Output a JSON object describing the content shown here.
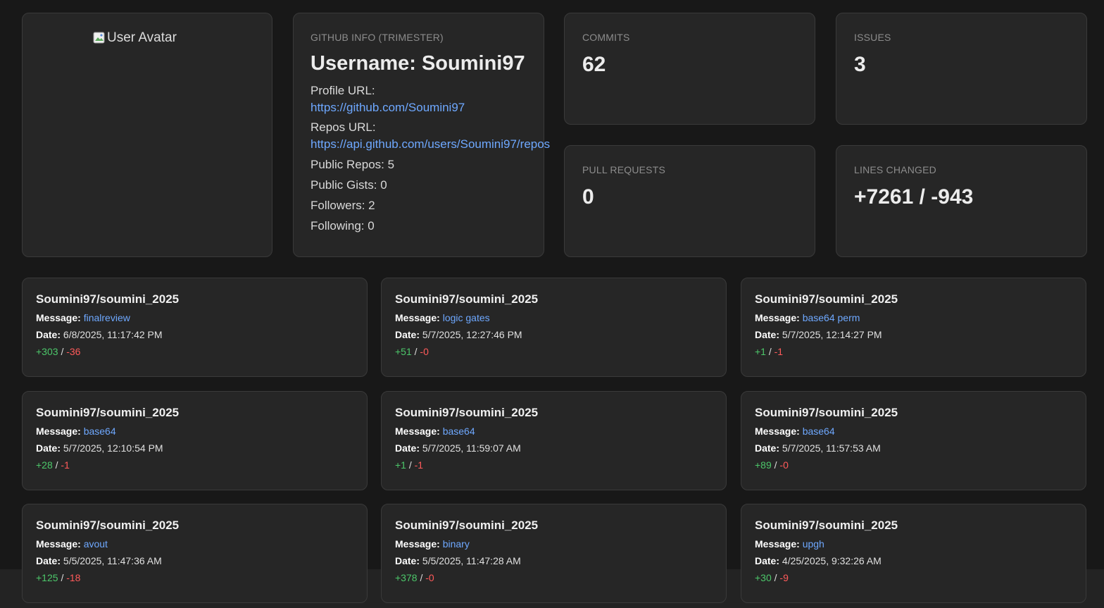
{
  "avatar": {
    "alt_text": "User Avatar"
  },
  "github_info": {
    "section_label": "GITHUB INFO (TRIMESTER)",
    "username": "Username: Soumini97",
    "profile_url_label": "Profile URL:",
    "profile_url": "https://github.com/Soumini97",
    "repos_url_label": "Repos URL:",
    "repos_url": "https://api.github.com/users/Soumini97/repos",
    "public_repos": "Public Repos: 5",
    "public_gists": "Public Gists: 0",
    "followers": "Followers: 2",
    "following": "Following: 0"
  },
  "stats": {
    "commits": {
      "label": "COMMITS",
      "value": "62"
    },
    "issues": {
      "label": "ISSUES",
      "value": "3"
    },
    "pull_requests": {
      "label": "PULL REQUESTS",
      "value": "0"
    },
    "lines_changed": {
      "label": "LINES CHANGED",
      "value": "+7261 / -943"
    }
  },
  "commit_labels": {
    "message": "Message:",
    "date": "Date:",
    "separator": "/"
  },
  "commits": [
    {
      "repo": "Soumini97/soumini_2025",
      "message": "finalreview",
      "date": "6/8/2025, 11:17:42 PM",
      "additions": "+303",
      "deletions": "-36"
    },
    {
      "repo": "Soumini97/soumini_2025",
      "message": "logic gates",
      "date": "5/7/2025, 12:27:46 PM",
      "additions": "+51",
      "deletions": "-0"
    },
    {
      "repo": "Soumini97/soumini_2025",
      "message": "base64 perm",
      "date": "5/7/2025, 12:14:27 PM",
      "additions": "+1",
      "deletions": "-1"
    },
    {
      "repo": "Soumini97/soumini_2025",
      "message": "base64",
      "date": "5/7/2025, 12:10:54 PM",
      "additions": "+28",
      "deletions": "-1"
    },
    {
      "repo": "Soumini97/soumini_2025",
      "message": "base64",
      "date": "5/7/2025, 11:59:07 AM",
      "additions": "+1",
      "deletions": "-1"
    },
    {
      "repo": "Soumini97/soumini_2025",
      "message": "base64",
      "date": "5/7/2025, 11:57:53 AM",
      "additions": "+89",
      "deletions": "-0"
    },
    {
      "repo": "Soumini97/soumini_2025",
      "message": "avout",
      "date": "5/5/2025, 11:47:36 AM",
      "additions": "+125",
      "deletions": "-18"
    },
    {
      "repo": "Soumini97/soumini_2025",
      "message": "binary",
      "date": "5/5/2025, 11:47:28 AM",
      "additions": "+378",
      "deletions": "-0"
    },
    {
      "repo": "Soumini97/soumini_2025",
      "message": "upgh",
      "date": "4/25/2025, 9:32:26 AM",
      "additions": "+30",
      "deletions": "-9"
    }
  ],
  "colors": {
    "background": "#181818",
    "card": "#262626",
    "link": "#6ea8ff",
    "additions": "#4cc76a",
    "deletions": "#ff5a5a"
  }
}
